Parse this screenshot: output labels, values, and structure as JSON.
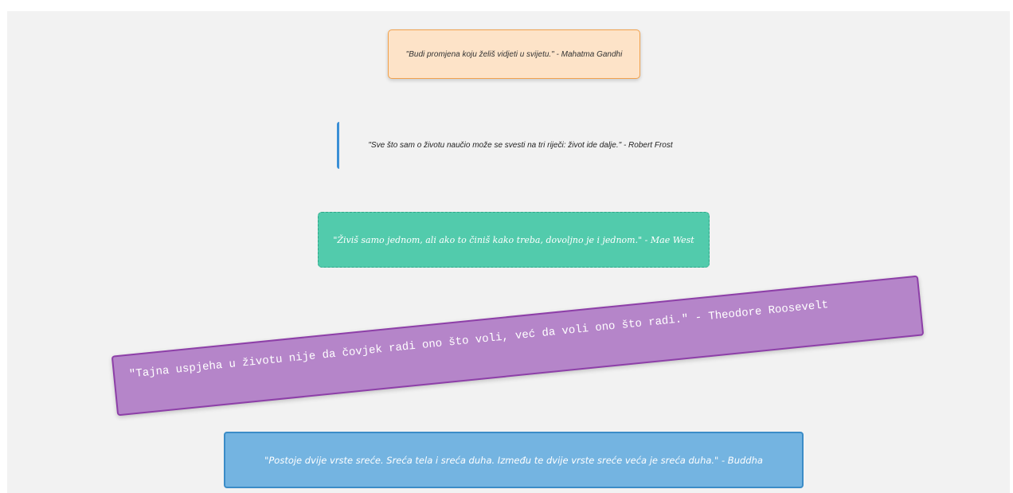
{
  "quotes": [
    {
      "text": "\"Budi promjena koju želiš vidjeti u svijetu.\" - Mahatma Gandhi"
    },
    {
      "text": "\"Sve što sam o životu naučio može se svesti na tri riječi: život ide dalje.\" - Robert Frost"
    },
    {
      "text": "\"Živiš samo jednom, ali ako to činiš kako treba, dovoljno je i jednom.\" - Mae West"
    },
    {
      "text": "\"Tajna uspjeha u životu nije da čovjek radi ono što voli, već da voli ono što radi.\" - Theodore Roosevelt"
    },
    {
      "text": "\"Postoje dvije vrste sreće. Sreća tela i sreća duha. Između te dvije vrste sreće veća je sreća duha.\" - Buddha"
    }
  ],
  "colors": {
    "page_background": "#f2f2f2",
    "orange_box": "#fde3c8",
    "blue_bar": "#3a8fd6",
    "teal_box": "#52cbac",
    "purple_box": "#b585c9",
    "blue_box": "#74b4e1"
  }
}
